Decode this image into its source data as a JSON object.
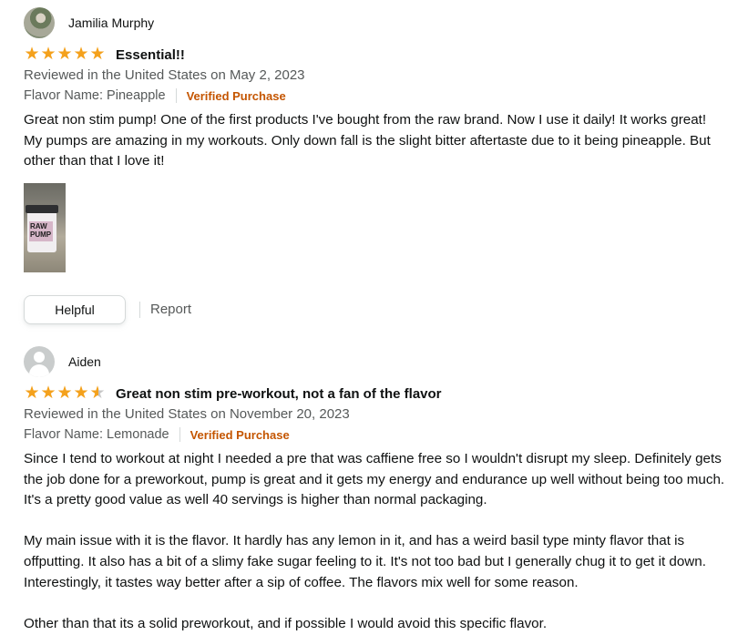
{
  "reviews": [
    {
      "author": "Jamilia Murphy",
      "avatar": "profile-photo",
      "rating": 5,
      "stars": [
        "full",
        "full",
        "full",
        "full",
        "full"
      ],
      "title": "Essential!!",
      "date_line": "Reviewed in the United States on May 2, 2023",
      "flavor": "Flavor Name: Pineapple",
      "verified": "Verified Purchase",
      "paragraphs": [
        "Great non stim pump! One of the first products I've bought from the raw brand. Now I use it daily! It works great! My pumps are amazing in my workouts. Only down fall is the slight bitter aftertaste due to it being pineapple. But other than that I love it!"
      ],
      "image_label": "RAW PUMP",
      "helpful_label": "Helpful",
      "report_label": "Report"
    },
    {
      "author": "Aiden",
      "avatar": "default-avatar-icon",
      "rating": 4.5,
      "stars": [
        "full",
        "full",
        "full",
        "full",
        "half"
      ],
      "title": "Great non stim pre-workout, not a fan of the flavor",
      "date_line": "Reviewed in the United States on November 20, 2023",
      "flavor": "Flavor Name: Lemonade",
      "verified": "Verified Purchase",
      "paragraphs": [
        "Since I tend to workout at night I needed a pre that was caffiene free so I wouldn't disrupt my sleep. Definitely gets the job done for a preworkout, pump is great and it gets my energy and endurance up well without being too much. It's a pretty good value as well 40 servings is higher than normal packaging.",
        "My main issue with it is the flavor. It hardly has any lemon in it, and has a weird basil type minty flavor that is offputting. It also has a bit of a slimy fake sugar feeling to it. It's not too bad but I generally chug it to get it down. Interestingly, it tastes way better after a sip of coffee. The flavors mix well for some reason.",
        "Other than that its a solid preworkout, and if possible I would avoid this specific flavor."
      ]
    }
  ],
  "colors": {
    "star": "#f4a11c",
    "verified": "#c45500",
    "meta": "#565959",
    "text": "#0f1111"
  }
}
